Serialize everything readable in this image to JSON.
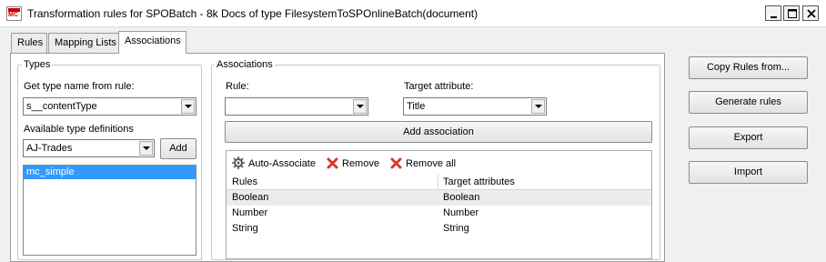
{
  "window": {
    "title": "Transformation rules for SPOBatch - 8k Docs of type FilesystemToSPOnlineBatch(document)",
    "icon_text": "MC"
  },
  "tabs": [
    {
      "label": "Rules",
      "active": false
    },
    {
      "label": "Mapping Lists",
      "active": false
    },
    {
      "label": "Associations",
      "active": true
    }
  ],
  "types": {
    "group_label": "Types",
    "get_type_label": "Get type name from rule:",
    "get_type_value": "s__contentType",
    "available_label": "Available type definitions",
    "available_value": "AJ-Trades",
    "add_label": "Add",
    "list_items": [
      {
        "label": "mc_simple",
        "selected": true
      }
    ]
  },
  "associations": {
    "group_label": "Associations",
    "rule_label": "Rule:",
    "rule_value": "",
    "target_label": "Target attribute:",
    "target_value": "Title",
    "add_association_label": "Add association",
    "toolbar": {
      "auto_associate": "Auto-Associate",
      "remove": "Remove",
      "remove_all": "Remove all"
    },
    "columns": [
      "Rules",
      "Target attributes"
    ],
    "rows": [
      {
        "rule": "Boolean",
        "target": "Boolean"
      },
      {
        "rule": "Number",
        "target": "Number"
      },
      {
        "rule": "String",
        "target": "String"
      }
    ]
  },
  "side_buttons": {
    "copy_rules": "Copy Rules from...",
    "generate_rules": "Generate rules",
    "export": "Export",
    "import": "Import"
  },
  "colors": {
    "selection": "#3399ff",
    "remove_icon": "#d23c2c"
  }
}
